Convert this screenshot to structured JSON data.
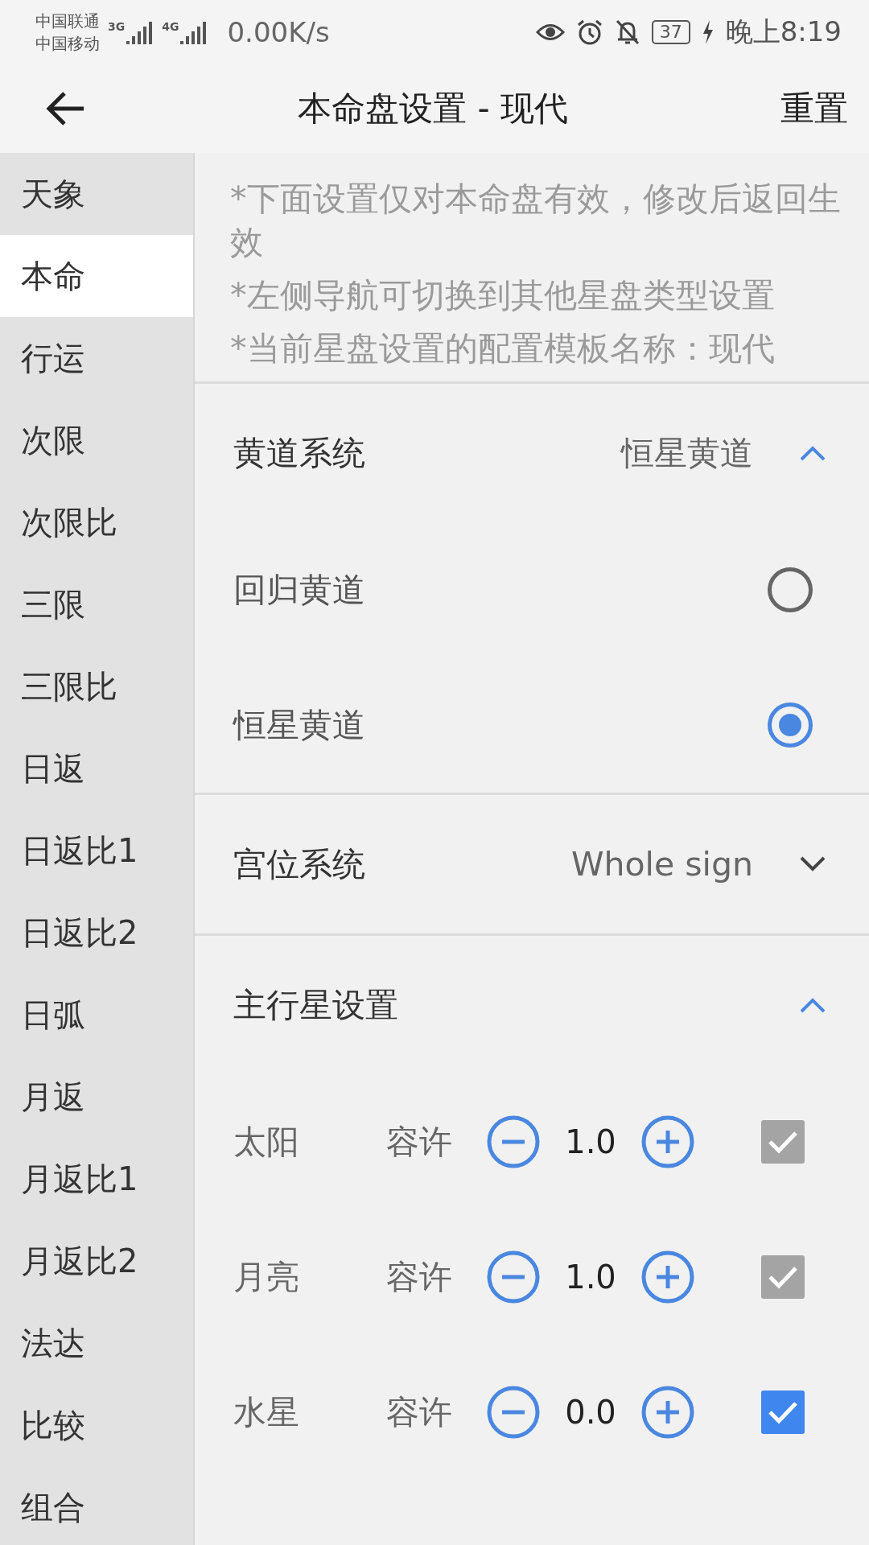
{
  "status_bar": {
    "carriers": [
      "中国联通",
      "中国移动"
    ],
    "networks": [
      "3G",
      "4G"
    ],
    "speed": "0.00K/s",
    "battery": "37",
    "time": "晚上8:19"
  },
  "header": {
    "title": "本命盘设置 - 现代",
    "action": "重置"
  },
  "sidebar": {
    "items": [
      {
        "label": "天象",
        "selected": false
      },
      {
        "label": "本命",
        "selected": true
      },
      {
        "label": "行运",
        "selected": false
      },
      {
        "label": "次限",
        "selected": false
      },
      {
        "label": "次限比",
        "selected": false
      },
      {
        "label": "三限",
        "selected": false
      },
      {
        "label": "三限比",
        "selected": false
      },
      {
        "label": "日返",
        "selected": false
      },
      {
        "label": "日返比1",
        "selected": false
      },
      {
        "label": "日返比2",
        "selected": false
      },
      {
        "label": "日弧",
        "selected": false
      },
      {
        "label": "月返",
        "selected": false
      },
      {
        "label": "月返比1",
        "selected": false
      },
      {
        "label": "月返比2",
        "selected": false
      },
      {
        "label": "法达",
        "selected": false
      },
      {
        "label": "比较",
        "selected": false
      },
      {
        "label": "组合",
        "selected": false
      }
    ]
  },
  "notes": [
    "*下面设置仅对本命盘有效，修改后返回生效",
    "*左侧导航可切换到其他星盘类型设置",
    "*当前星盘设置的配置模板名称：现代"
  ],
  "sections": [
    {
      "kind": "radio",
      "title": "黄道系统",
      "value": "恒星黄道",
      "expanded": true,
      "options": [
        {
          "label": "回归黄道",
          "selected": false
        },
        {
          "label": "恒星黄道",
          "selected": true
        }
      ]
    },
    {
      "kind": "dropdown",
      "title": "宫位系统",
      "value": "Whole sign",
      "expanded": false
    },
    {
      "kind": "planets",
      "title": "主行星设置",
      "expanded": true,
      "rows": [
        {
          "name": "太阳",
          "label": "容许",
          "value": "1.0",
          "checked": true,
          "disabled": true
        },
        {
          "name": "月亮",
          "label": "容许",
          "value": "1.0",
          "checked": true,
          "disabled": true
        },
        {
          "name": "水星",
          "label": "容许",
          "value": "0.0",
          "checked": true,
          "disabled": false
        }
      ]
    }
  ]
}
